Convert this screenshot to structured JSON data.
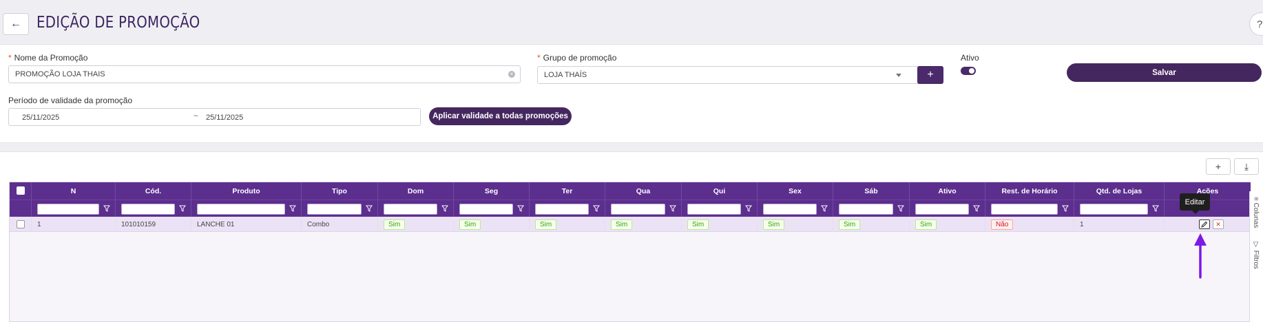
{
  "header": {
    "title": "EDIÇÃO DE PROMOÇÃO",
    "back_icon": "←",
    "help_icon": "?"
  },
  "form": {
    "nome_label": "Nome da Promoção",
    "nome_value": "PROMOÇÃO LOJA THAIS",
    "grupo_label": "Grupo de promoção",
    "grupo_value": "LOJA THAÍS",
    "ativo_label": "Ativo",
    "ativo_on": true,
    "salvar_label": "Salvar",
    "periodo_label": "Período de validade da promoção",
    "date_start": "25/11/2025",
    "date_sep": "~",
    "date_end": "25/11/2025",
    "aplicar_label": "Aplicar validade a todas promoções",
    "add_grupo_icon": "+",
    "required_mark": "*"
  },
  "toolbar": {
    "add_icon": "+",
    "download_icon": "⤓"
  },
  "grid": {
    "columns": [
      "N",
      "Cód.",
      "Produto",
      "Tipo",
      "Dom",
      "Seg",
      "Ter",
      "Qua",
      "Qui",
      "Sex",
      "Sáb",
      "Ativo",
      "Rest. de Horário",
      "Qtd. de Lojas",
      "Ações"
    ],
    "row": {
      "n": "1",
      "cod": "101010159",
      "produto": "LANCHE 01",
      "tipo": "Combo",
      "dom": "Sim",
      "seg": "Sim",
      "ter": "Sim",
      "qua": "Sim",
      "qui": "Sim",
      "sex": "Sim",
      "sab": "Sim",
      "ativo": "Sim",
      "rest": "Não",
      "qtd": "1"
    },
    "edit_icon": "pencil-icon",
    "delete_icon": "✕"
  },
  "side_tabs": {
    "colunas": "Colunas",
    "filtros": "Filtros"
  },
  "tooltip": {
    "text": "Editar"
  },
  "colors": {
    "brand": "#45275f",
    "grid_header": "#5c2e8e",
    "row_highlight": "#ece2f6",
    "arrow": "#7c19e6"
  }
}
